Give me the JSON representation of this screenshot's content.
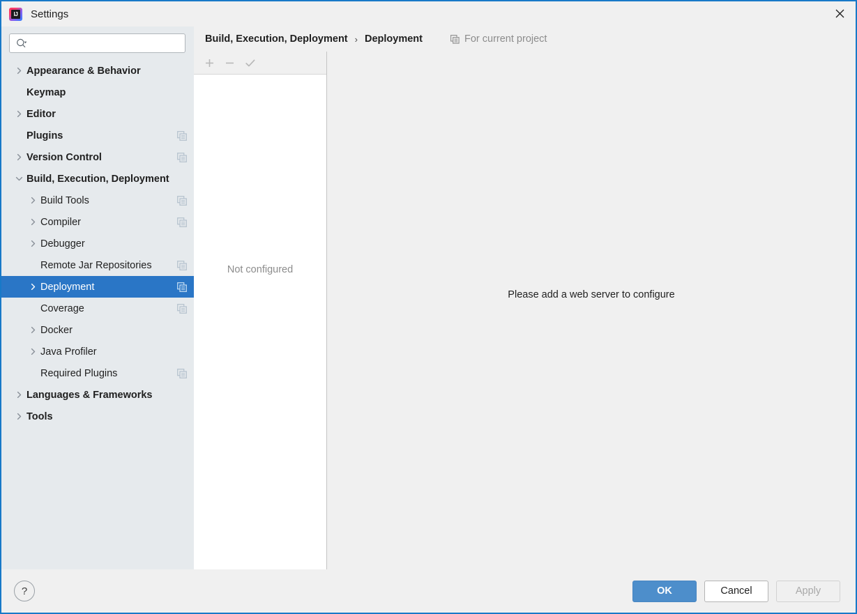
{
  "window": {
    "title": "Settings",
    "logo_icon": "intellij-idea-logo",
    "close_icon": "close-icon"
  },
  "search": {
    "value": "",
    "placeholder": "",
    "icon": "search-icon",
    "dropdown_icon": "chevron-down-icon"
  },
  "sidebar": {
    "items": [
      {
        "label": "Appearance & Behavior",
        "level": 0,
        "expander": "collapsed",
        "copy_icon": false,
        "selected": false
      },
      {
        "label": "Keymap",
        "level": 0,
        "expander": "none",
        "copy_icon": false,
        "selected": false
      },
      {
        "label": "Editor",
        "level": 0,
        "expander": "collapsed",
        "copy_icon": false,
        "selected": false
      },
      {
        "label": "Plugins",
        "level": 0,
        "expander": "none",
        "copy_icon": true,
        "selected": false
      },
      {
        "label": "Version Control",
        "level": 0,
        "expander": "collapsed",
        "copy_icon": true,
        "selected": false
      },
      {
        "label": "Build, Execution, Deployment",
        "level": 0,
        "expander": "expanded",
        "copy_icon": false,
        "selected": false
      },
      {
        "label": "Build Tools",
        "level": 1,
        "expander": "collapsed",
        "copy_icon": true,
        "selected": false
      },
      {
        "label": "Compiler",
        "level": 1,
        "expander": "collapsed",
        "copy_icon": true,
        "selected": false
      },
      {
        "label": "Debugger",
        "level": 1,
        "expander": "collapsed",
        "copy_icon": false,
        "selected": false
      },
      {
        "label": "Remote Jar Repositories",
        "level": 1,
        "expander": "none",
        "copy_icon": true,
        "selected": false
      },
      {
        "label": "Deployment",
        "level": 1,
        "expander": "collapsed",
        "copy_icon": true,
        "selected": true
      },
      {
        "label": "Coverage",
        "level": 1,
        "expander": "none",
        "copy_icon": true,
        "selected": false
      },
      {
        "label": "Docker",
        "level": 1,
        "expander": "collapsed",
        "copy_icon": false,
        "selected": false
      },
      {
        "label": "Java Profiler",
        "level": 1,
        "expander": "collapsed",
        "copy_icon": false,
        "selected": false
      },
      {
        "label": "Required Plugins",
        "level": 1,
        "expander": "none",
        "copy_icon": true,
        "selected": false
      },
      {
        "label": "Languages & Frameworks",
        "level": 0,
        "expander": "collapsed",
        "copy_icon": false,
        "selected": false
      },
      {
        "label": "Tools",
        "level": 0,
        "expander": "collapsed",
        "copy_icon": false,
        "selected": false
      }
    ]
  },
  "header": {
    "breadcrumb_parent": "Build, Execution, Deployment",
    "breadcrumb_separator": "›",
    "breadcrumb_current": "Deployment",
    "scope_note": "For current project",
    "scope_icon": "copy-project-icon"
  },
  "toolbar": {
    "add_icon": "plus-icon",
    "remove_icon": "minus-icon",
    "set_default_icon": "check-icon"
  },
  "list_panel": {
    "empty_text": "Not configured"
  },
  "main": {
    "message": "Please add a web server to configure"
  },
  "footer": {
    "help_label": "?",
    "ok_label": "OK",
    "cancel_label": "Cancel",
    "apply_label": "Apply"
  },
  "colors": {
    "window_border": "#1879c8",
    "selection": "#2a76c6",
    "sidebar_bg": "#e6eaed",
    "panel_bg": "#f0f0f0",
    "primary_button": "#4d8ecb",
    "muted_text": "#8c8c8c"
  }
}
